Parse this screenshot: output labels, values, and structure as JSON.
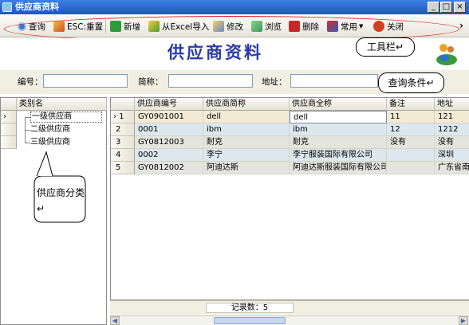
{
  "window": {
    "title": "供应商资料",
    "controls": {
      "minimize": "_",
      "maximize": "□",
      "close": "×"
    }
  },
  "toolbar": {
    "buttons": [
      {
        "label": "查询",
        "icon": "search-icon",
        "color": "#3a78c8"
      },
      {
        "label": "ESC:重置",
        "icon": "reset-icon",
        "color": "#d24a2a"
      },
      {
        "label": "新增",
        "icon": "add-icon",
        "color": "#2e9a3a"
      },
      {
        "label": "从Excel导入",
        "icon": "excel-import-icon",
        "color": "#4a9a2a"
      },
      {
        "label": "修改",
        "icon": "edit-icon",
        "color": "#d4a020"
      },
      {
        "label": "浏览",
        "icon": "browse-icon",
        "color": "#3a9a5a"
      },
      {
        "label": "删除",
        "icon": "delete-icon",
        "color": "#c82828"
      },
      {
        "label": "常用",
        "icon": "favorites-icon",
        "color": "#c83030",
        "has_dropdown": true
      },
      {
        "label": "关闭",
        "icon": "close-icon",
        "color": "#d04020"
      }
    ],
    "overflow_arrow": "›"
  },
  "page": {
    "title": "供应商资料"
  },
  "annotations": {
    "toolbar": "工具栏↵",
    "query": "查询条件↵",
    "category": "供应商分类↵"
  },
  "query": {
    "fields": [
      {
        "label": "编号：",
        "value": ""
      },
      {
        "label": "简称：",
        "value": ""
      },
      {
        "label": "地址：",
        "value": ""
      }
    ]
  },
  "category_grid": {
    "header": "类别名",
    "items": [
      {
        "label": "一级供应商",
        "selected": true
      },
      {
        "label": "二级供应商",
        "selected": false
      },
      {
        "label": "三级供应商",
        "selected": false
      }
    ]
  },
  "supplier_grid": {
    "columns": [
      "供应商编号",
      "供应商简称",
      "供应商全称",
      "备注",
      "地址"
    ],
    "rows": [
      {
        "num": "1",
        "cells": [
          "GY0901001",
          "dell",
          "dell",
          "11",
          "121"
        ],
        "current": true
      },
      {
        "num": "2",
        "cells": [
          "0001",
          "ibm",
          "ibm",
          "12",
          "1212"
        ],
        "current": false
      },
      {
        "num": "3",
        "cells": [
          "GY0812003",
          "耐克",
          "耐克",
          "没有",
          "没有"
        ],
        "current": false
      },
      {
        "num": "4",
        "cells": [
          "0002",
          "李宁",
          "李宁服装国际有限公司",
          "",
          "深圳"
        ],
        "current": false
      },
      {
        "num": "5",
        "cells": [
          "GY0812002",
          "阿迪达斯",
          "阿迪达斯服装国际有限公司",
          "",
          "广东省南"
        ],
        "current": false
      }
    ],
    "status_label": "记录数：5"
  },
  "colors": {
    "selected_row": "#f3ead5",
    "row_alt_blue": "#dde8ee",
    "row_alt_gray": "#e4e5df",
    "annotation_red": "#e02020",
    "title_blue": "#2b3aa8"
  }
}
